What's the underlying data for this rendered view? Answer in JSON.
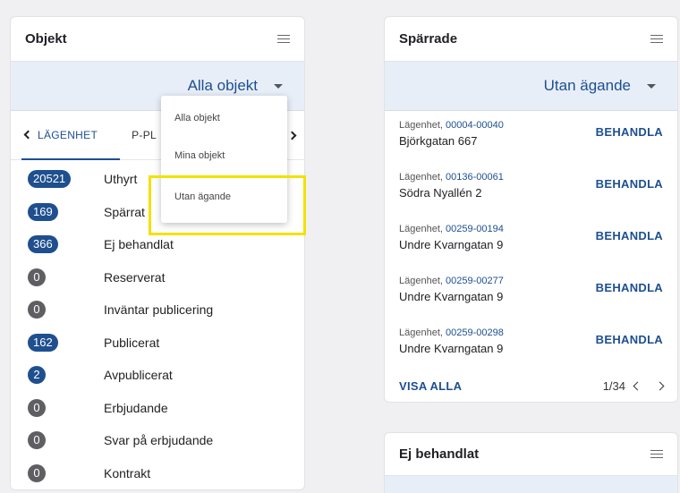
{
  "objekt_card": {
    "title": "Objekt",
    "filter_value": "Alla objekt",
    "tabs": [
      {
        "label": "LÄGENHET"
      },
      {
        "label": "P-PL"
      }
    ],
    "statuses": [
      {
        "count": "20521",
        "label": "Uthyrt",
        "color": "blue"
      },
      {
        "count": "169",
        "label": "Spärrat",
        "color": "blue"
      },
      {
        "count": "366",
        "label": "Ej behandlat",
        "color": "blue"
      },
      {
        "count": "0",
        "label": "Reserverat",
        "color": "gray"
      },
      {
        "count": "0",
        "label": "Inväntar publicering",
        "color": "gray"
      },
      {
        "count": "162",
        "label": "Publicerat",
        "color": "blue"
      },
      {
        "count": "2",
        "label": "Avpublicerat",
        "color": "blue"
      },
      {
        "count": "0",
        "label": "Erbjudande",
        "color": "gray"
      },
      {
        "count": "0",
        "label": "Svar på erbjudande",
        "color": "gray"
      },
      {
        "count": "0",
        "label": "Kontrakt",
        "color": "gray"
      }
    ]
  },
  "dropdown": {
    "options": [
      "Alla objekt",
      "Mina objekt",
      "Utan ägande"
    ]
  },
  "sparrade_card": {
    "title": "Spärrade",
    "filter_value": "Utan ägande",
    "entries": [
      {
        "type": "Lägenhet,",
        "code": "00004-00040",
        "address": "Björkgatan 667",
        "action": "BEHANDLA"
      },
      {
        "type": "Lägenhet,",
        "code": "00136-00061",
        "address": "Södra Nyallén 2",
        "action": "BEHANDLA"
      },
      {
        "type": "Lägenhet,",
        "code": "00259-00194",
        "address": "Undre Kvarngatan 9",
        "action": "BEHANDLA"
      },
      {
        "type": "Lägenhet,",
        "code": "00259-00277",
        "address": "Undre Kvarngatan 9",
        "action": "BEHANDLA"
      },
      {
        "type": "Lägenhet,",
        "code": "00259-00298",
        "address": "Undre Kvarngatan 9",
        "action": "BEHANDLA"
      }
    ],
    "visa_alla": "VISA ALLA",
    "pagination": "1/34"
  },
  "ejbehandlat_card": {
    "title": "Ej behandlat"
  },
  "colors": {
    "primary": "#1d4f91",
    "badge_blue": "#1f4f8e",
    "badge_gray": "#5f5f63",
    "highlight": "#f2e200",
    "select_bar": "#e8eef8"
  }
}
